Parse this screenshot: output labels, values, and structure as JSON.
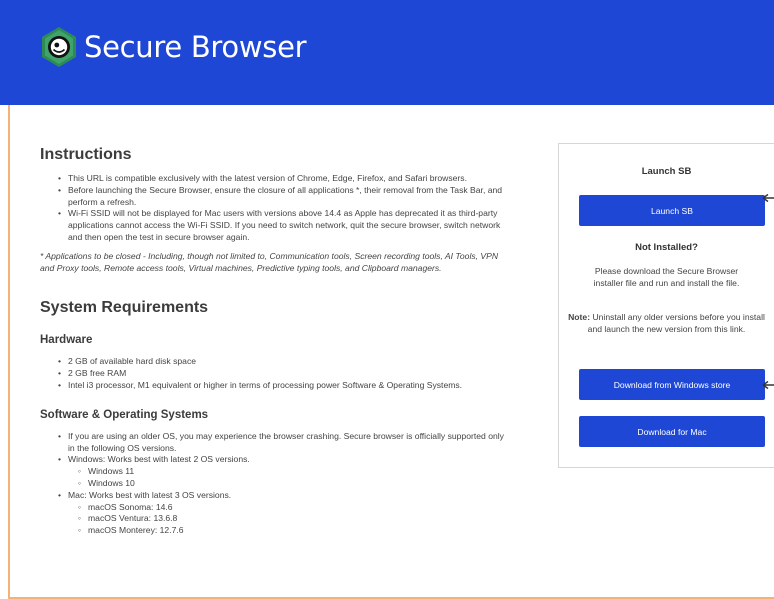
{
  "header": {
    "brand": "Secure Browser",
    "colors": {
      "header_bg": "#1e47d6",
      "logo_hex": "#2e8b57",
      "button_bg": "#1e47d6"
    }
  },
  "instructions": {
    "title": "Instructions",
    "items": [
      "This URL is compatible exclusively with the latest version of Chrome, Edge, Firefox, and Safari browsers.",
      "Before launching the Secure Browser, ensure the closure of all applications *, their removal from the Task Bar, and perform a refresh.",
      "Wi-Fi SSID will not be displayed for Mac users with versions above 14.4 as Apple has deprecated it as third-party applications cannot access the Wi-Fi SSID. If you need to switch network, quit the secure browser, switch network and then open the test in secure browser again."
    ],
    "note": "* Applications to be closed - Including, though not limited to, Communication tools, Screen recording tools, AI Tools, VPN and Proxy tools, Remote access tools, Virtual machines, Predictive typing tools, and Clipboard managers."
  },
  "system": {
    "title": "System Requirements",
    "hardware": {
      "title": "Hardware",
      "items": [
        "2 GB of available hard disk space",
        "2 GB free RAM",
        "Intel i3 processor, M1 equivalent or higher in terms of processing power Software & Operating Systems."
      ]
    },
    "software": {
      "title": "Software & Operating Systems",
      "intro": "If you are using an older OS, you may experience the browser crashing. Secure browser is officially supported only in the following OS versions.",
      "windows_label": "Windows: Works best with latest 2 OS versions.",
      "windows_versions": [
        "Windows 11",
        "Windows 10"
      ],
      "mac_label": "Mac: Works best with latest 3 OS versions.",
      "mac_versions": [
        "macOS Sonoma: 14.6",
        "macOS Ventura: 13.6.8",
        "macOS Monterey: 12.7.6"
      ]
    }
  },
  "panel": {
    "launch_title": "Launch SB",
    "launch_button": "Launch SB",
    "not_installed_title": "Not Installed?",
    "download_text": "Please download the Secure Browser installer file and run and install the file.",
    "note_label": "Note:",
    "note_text": " Uninstall any older versions before you install and launch the new version from this link.",
    "windows_button": "Download from Windows store",
    "mac_button": "Download for Mac"
  }
}
